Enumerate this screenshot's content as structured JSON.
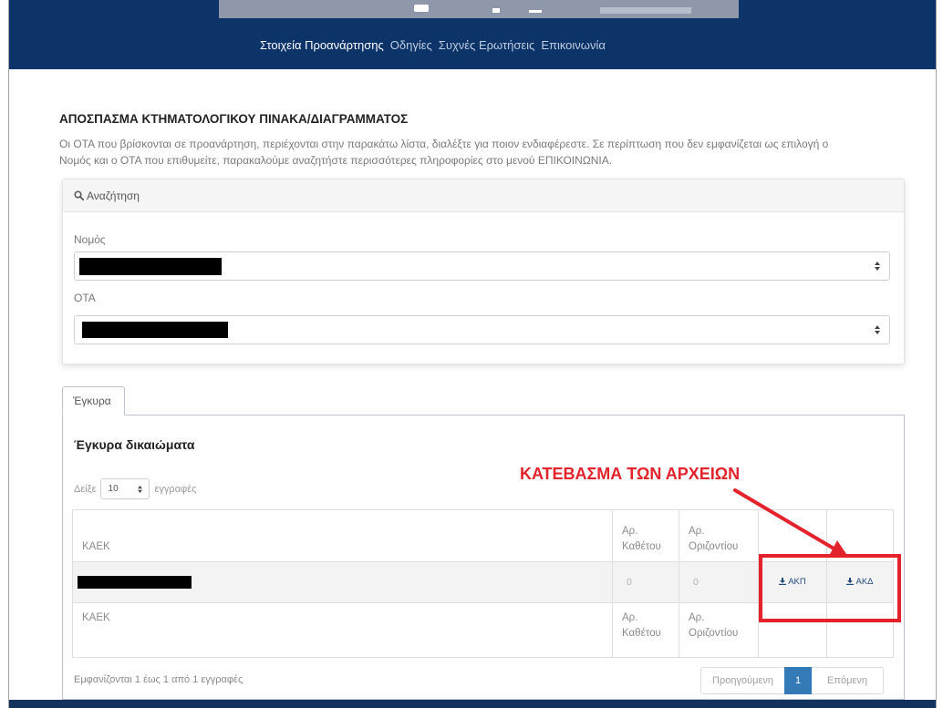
{
  "header": {
    "nav": [
      {
        "label": "Στοιχεία Προανάρτησης",
        "active": true
      },
      {
        "label": "Οδηγίες",
        "active": false
      },
      {
        "label": "Συχνές Ερωτήσεις",
        "active": false
      },
      {
        "label": "Επικοινωνία",
        "active": false
      }
    ]
  },
  "page": {
    "title": "ΑΠΟΣΠΑΣΜΑ ΚΤΗΜΑΤΟΛΟΓΙΚΟΥ ΠΙΝΑΚΑ/ΔΙΑΓΡΑΜΜΑΤΟΣ",
    "intro_lines": [
      "Οι ΟΤΑ που βρίσκονται σε προανάρτηση, περιέχονται στην παρακάτω λίστα, διαλέξτε για ποιον ενδιαφέρεστε. Σε περίπτωση που δεν εμφανίζεται ως επιλογή ο",
      "Νομός και ο ΟΤΑ που επιθυμείτε, παρακαλούμε αναζητήστε περισσότερες πληροφορίες στο μενού ΕΠΙΚΟΙΝΩΝΙΑ."
    ]
  },
  "search": {
    "heading": "Αναζήτηση",
    "heading_icon": "search-icon",
    "select_icon": "select-caret-icon",
    "prefecture": {
      "label": "Νομός",
      "value_redacted": true
    },
    "municipality": {
      "label": "ΟΤΑ",
      "value_redacted": true
    }
  },
  "tabs": [
    {
      "label": "Έγκυρα",
      "active": true
    }
  ],
  "rights": {
    "heading": "Έγκυρα δικαιώματα",
    "page_length": {
      "prefix": "Δείξε",
      "value": "10",
      "suffix": "εγγραφές"
    },
    "columns": [
      "ΚΑΕΚ",
      "Αρ. Καθέτου",
      "Αρ. Οριζοντίου"
    ],
    "rows": [
      {
        "kaek_redacted": true,
        "vertical": "0",
        "horizontal": "0",
        "downloads": [
          {
            "label": "ΑΚΠ",
            "icon": "download-icon"
          },
          {
            "label": "ΑΚΔ",
            "icon": "download-icon"
          }
        ]
      }
    ],
    "info": "Εμφανίζονται 1 έως 1 από 1 εγγραφές",
    "pagination": {
      "previous": "Προηγούμενη",
      "current_page": "1",
      "next": "Επόμενη"
    }
  },
  "annotation": {
    "text": "ΚΑΤΕΒΑΣΜΑ ΤΩΝ ΑΡΧΕΙΩΝ"
  },
  "colors": {
    "nav_background": "#0d3468",
    "annotation_red": "#e3222b",
    "pagination_active": "#337ab7",
    "download_link": "#1f4a7c"
  }
}
